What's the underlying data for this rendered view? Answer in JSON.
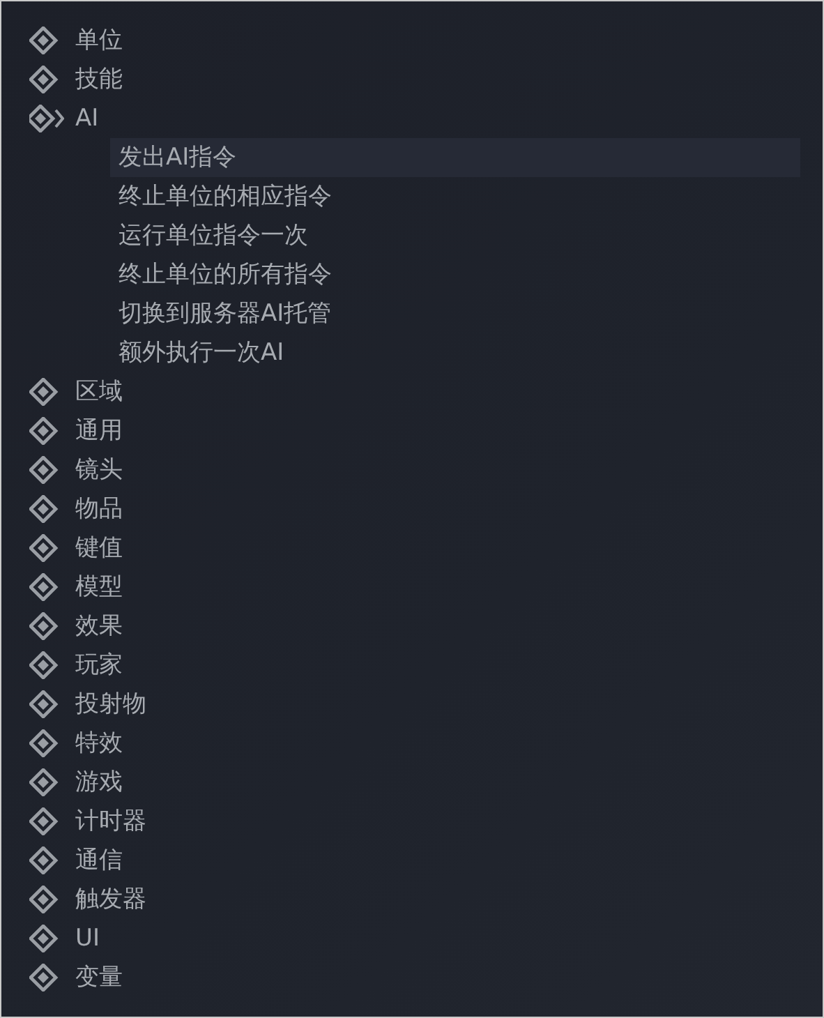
{
  "tree": [
    {
      "label": "单位",
      "expanded": false
    },
    {
      "label": "技能",
      "expanded": false
    },
    {
      "label": "AI",
      "expanded": true,
      "children": [
        {
          "label": "发出AI指令",
          "selected": true
        },
        {
          "label": "终止单位的相应指令",
          "selected": false
        },
        {
          "label": "运行单位指令一次",
          "selected": false
        },
        {
          "label": "终止单位的所有指令",
          "selected": false
        },
        {
          "label": "切换到服务器AI托管",
          "selected": false
        },
        {
          "label": "额外执行一次AI",
          "selected": false
        }
      ]
    },
    {
      "label": "区域",
      "expanded": false
    },
    {
      "label": "通用",
      "expanded": false
    },
    {
      "label": "镜头",
      "expanded": false
    },
    {
      "label": "物品",
      "expanded": false
    },
    {
      "label": "键值",
      "expanded": false
    },
    {
      "label": "模型",
      "expanded": false
    },
    {
      "label": "效果",
      "expanded": false
    },
    {
      "label": "玩家",
      "expanded": false
    },
    {
      "label": "投射物",
      "expanded": false
    },
    {
      "label": "特效",
      "expanded": false
    },
    {
      "label": "游戏",
      "expanded": false
    },
    {
      "label": "计时器",
      "expanded": false
    },
    {
      "label": "通信",
      "expanded": false
    },
    {
      "label": "触发器",
      "expanded": false
    },
    {
      "label": "UI",
      "expanded": false
    },
    {
      "label": "变量",
      "expanded": false
    }
  ]
}
